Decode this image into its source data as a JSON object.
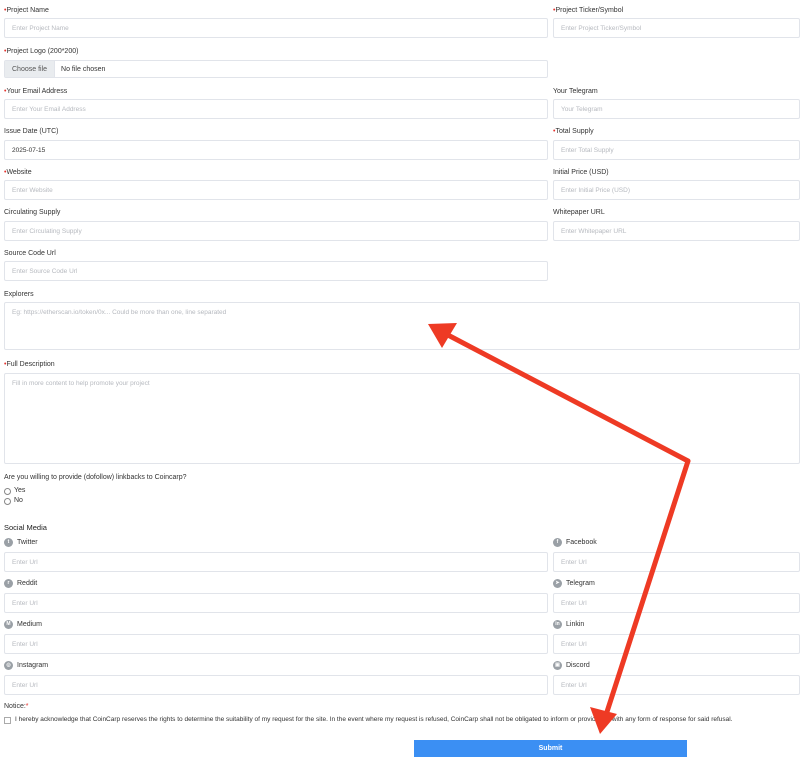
{
  "form": {
    "project_name": {
      "label": "Project Name",
      "placeholder": "Enter Project Name"
    },
    "ticker": {
      "label": "Project Ticker/Symbol",
      "placeholder": "Enter Project Ticker/Symbol"
    },
    "logo": {
      "label": "Project Logo (200*200)",
      "button": "Choose file",
      "status": "No file chosen"
    },
    "email": {
      "label": "Your Email Address",
      "placeholder": "Enter Your Email Address"
    },
    "telegram": {
      "label": "Your Telegram",
      "placeholder": "Your Telegram"
    },
    "issue_date": {
      "label": "Issue Date (UTC)",
      "value": "2025-07-15"
    },
    "total_supply": {
      "label": "Total Supply",
      "placeholder": "Enter Total Supply"
    },
    "website": {
      "label": "Website",
      "placeholder": "Enter Website"
    },
    "initial_price": {
      "label": "Initial Price (USD)",
      "placeholder": "Enter Initial Price (USD)"
    },
    "circulating_supply": {
      "label": "Circulating Supply",
      "placeholder": "Enter Circulating Supply"
    },
    "whitepaper": {
      "label": "Whitepaper URL",
      "placeholder": "Enter Whitepaper URL"
    },
    "source_code": {
      "label": "Source Code Url",
      "placeholder": "Enter Source Code Url"
    },
    "explorers": {
      "label": "Explorers",
      "placeholder": "Eg: https://etherscan.io/token/0x... Could be more than one, line separated"
    },
    "description": {
      "label": "Full Description",
      "placeholder": "Fill in more content to help promote your project"
    },
    "backlinks": {
      "question": "Are you willing to provide (dofollow) linkbacks to Coincarp?",
      "options": [
        "Yes",
        "No"
      ]
    }
  },
  "social": {
    "title": "Social Media",
    "placeholder": "Enter Url",
    "items": [
      {
        "name": "Twitter",
        "icon": "twitter-icon"
      },
      {
        "name": "Facebook",
        "icon": "facebook-icon"
      },
      {
        "name": "Reddit",
        "icon": "reddit-icon"
      },
      {
        "name": "Telegram",
        "icon": "telegram-icon"
      },
      {
        "name": "Medium",
        "icon": "medium-icon"
      },
      {
        "name": "Linkin",
        "icon": "linkedin-icon"
      },
      {
        "name": "Instagram",
        "icon": "instagram-icon"
      },
      {
        "name": "Discord",
        "icon": "discord-icon"
      }
    ]
  },
  "notice": {
    "label": "Notice:",
    "required_mark": "*",
    "text": "I hereby acknowledge that CoinCarp reserves the rights to determine the suitability of my request for the site. In the event where my request is refused, CoinCarp shall not be obligated to inform or provide me with any form of response for said refusal."
  },
  "submit_label": "Submit",
  "required_mark": "•",
  "colors": {
    "accent": "#3b8ff3",
    "required": "#e5322d",
    "annotation_arrow": "#ee3a24"
  }
}
